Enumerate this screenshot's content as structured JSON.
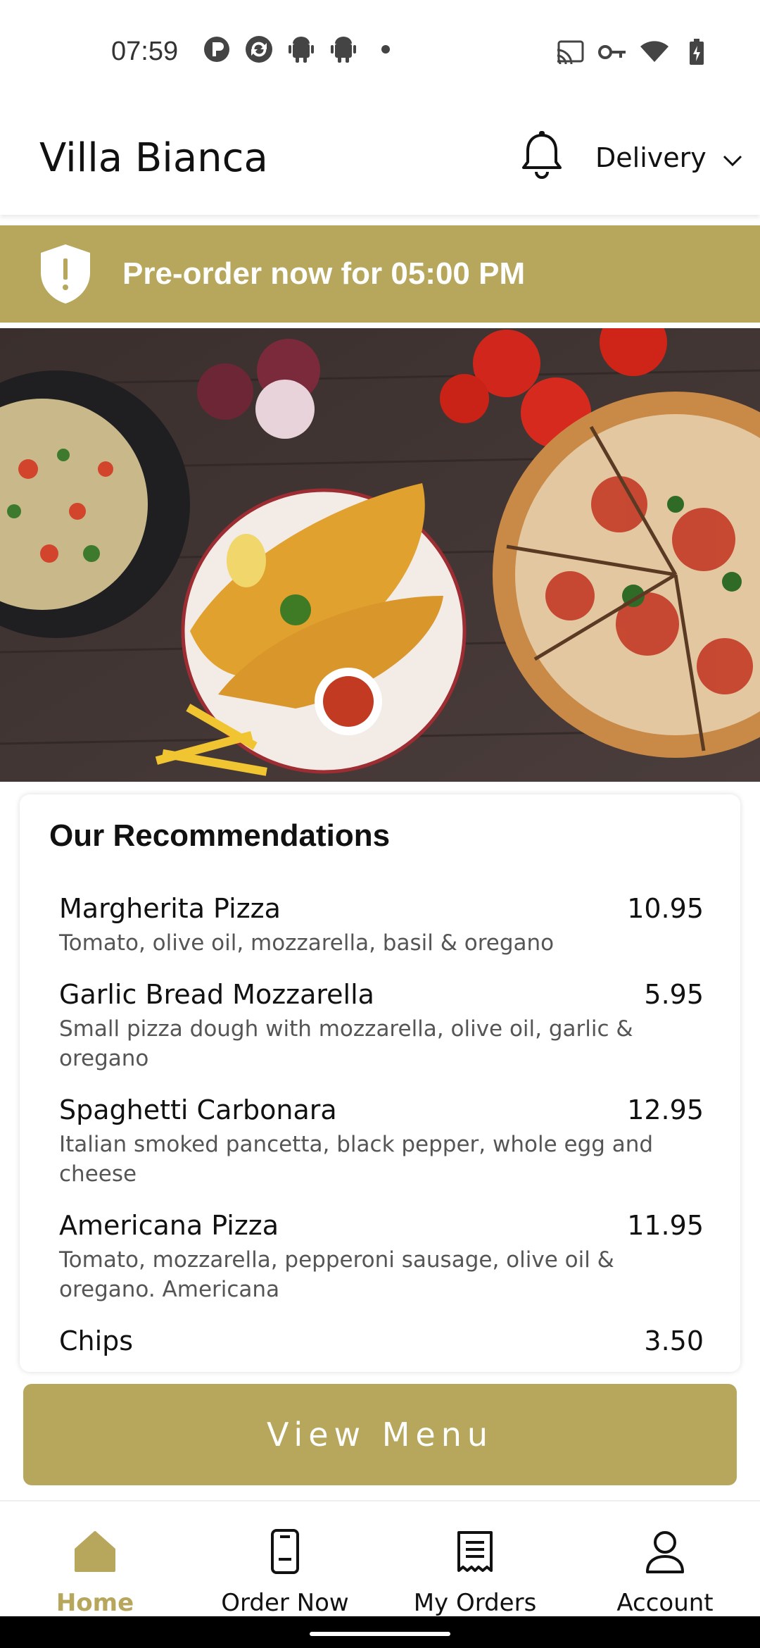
{
  "status_bar": {
    "time": "07:59",
    "left_icons": [
      "p-app-icon",
      "sync-app-icon",
      "android-icon",
      "android-icon",
      "dot-icon"
    ],
    "right_icons": [
      "cast-icon",
      "vpn-key-icon",
      "wifi-icon",
      "battery-charging-icon"
    ]
  },
  "header": {
    "title": "Villa Bianca",
    "bell_icon": "bell-icon",
    "delivery_label": "Delivery",
    "delivery_icon": "chevron-down-icon"
  },
  "banner": {
    "text": "Pre-order now for 05:00 PM",
    "icon": "shield-alert-icon",
    "color": "#b6a75d"
  },
  "hero": {
    "description_icon": "food-photo"
  },
  "recommendations": {
    "title": "Our Recommendations",
    "items": [
      {
        "name": "Margherita Pizza",
        "price": "10.95",
        "description": "Tomato, olive oil, mozzarella, basil & oregano"
      },
      {
        "name": "Garlic Bread Mozzarella",
        "price": "5.95",
        "description": "Small pizza dough with mozzarella, olive oil, garlic & oregano"
      },
      {
        "name": "Spaghetti Carbonara",
        "price": "12.95",
        "description": "Italian smoked pancetta, black pepper, whole egg and cheese"
      },
      {
        "name": "Americana Pizza",
        "price": "11.95",
        "description": "Tomato, mozzarella, pepperoni sausage, olive oil & oregano. Americana"
      },
      {
        "name": "Chips",
        "price": "3.50",
        "description": ""
      }
    ]
  },
  "view_menu_label": "View Menu",
  "bottom_nav": {
    "items": [
      {
        "label": "Home",
        "icon": "home-icon",
        "active": true
      },
      {
        "label": "Order Now",
        "icon": "phone-order-icon",
        "active": false
      },
      {
        "label": "My Orders",
        "icon": "receipt-icon",
        "active": false
      },
      {
        "label": "Account",
        "icon": "person-icon",
        "active": false
      }
    ]
  },
  "colors": {
    "accent": "#b6a75d",
    "text": "#111111",
    "muted": "#555555"
  }
}
